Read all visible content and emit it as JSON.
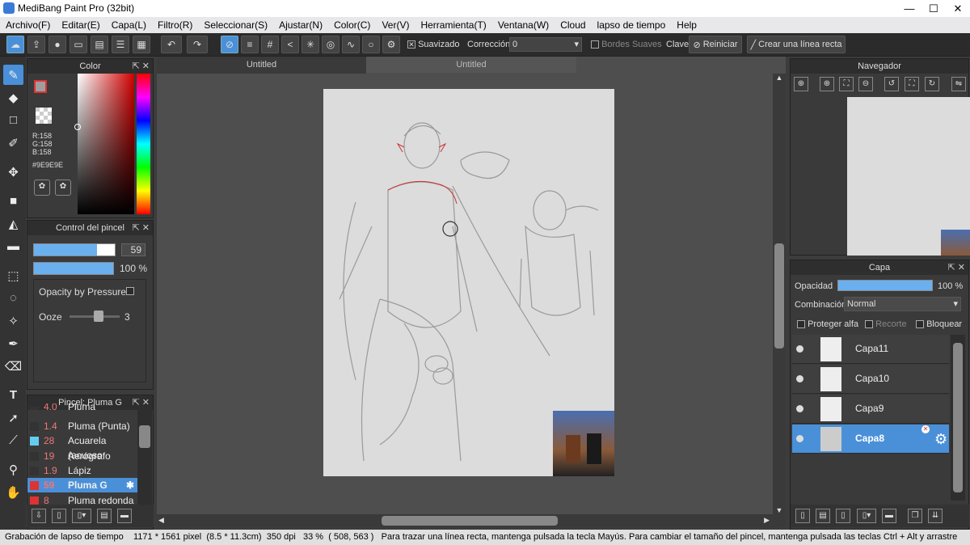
{
  "window": {
    "title": "MediBang Paint Pro (32bit)",
    "minimize": "—",
    "maximize": "☐",
    "close": "✕"
  },
  "menu": [
    "Archivo(F)",
    "Editar(E)",
    "Capa(L)",
    "Filtro(R)",
    "Seleccionar(S)",
    "Ajustar(N)",
    "Color(C)",
    "Ver(V)",
    "Herramienta(T)",
    "Ventana(W)",
    "Cloud",
    "lapso de tiempo",
    "Help"
  ],
  "toolbar": {
    "smoothing_label": "Suavizado",
    "correction_label": "Corrección",
    "correction_value": "0",
    "soft_edges_label": "Bordes Suaves",
    "clave_label": "Clave",
    "reset_label": "Reiniciar",
    "straight_line_label": "Crear una línea recta"
  },
  "tabs": [
    "Untitled",
    "Untitled"
  ],
  "color_panel": {
    "title": "Color",
    "r": "R:158",
    "g": "G:158",
    "b": "B:158",
    "hex": "#9E9E9E",
    "current_color": "#9e9e9e"
  },
  "brush_control": {
    "title": "Control del pincel",
    "size": "59",
    "opacity": "100 %",
    "opacity_pressure_label": "Opacity by Pressure",
    "ooze_label": "Ooze",
    "ooze_value": "3"
  },
  "brush_list": {
    "title": "Pincel: Pluma G",
    "items": [
      {
        "size": "4.0",
        "name": "Pluma",
        "color": "#333333"
      },
      {
        "size": "1.4",
        "name": "Pluma (Punta)",
        "color": "#333333"
      },
      {
        "size": "28",
        "name": "Acuarela (acuoso",
        "color": "#66ccee"
      },
      {
        "size": "19",
        "name": "Aerógrafo",
        "color": "#333333"
      },
      {
        "size": "1.9",
        "name": "Lápiz",
        "color": "#333333"
      },
      {
        "size": "59",
        "name": "Pluma G",
        "color": "#dd3333"
      },
      {
        "size": "8",
        "name": "Pluma redonda",
        "color": "#dd3333"
      }
    ]
  },
  "navigator": {
    "title": "Navegador"
  },
  "layers_panel": {
    "title": "Capa",
    "opacity_label": "Opacidad",
    "opacity_value": "100 %",
    "blend_label": "Combinación",
    "blend_value": "Normal",
    "protect_alpha": "Proteger alfa",
    "clip": "Recorte",
    "lock": "Bloquear",
    "layers": [
      "Capa11",
      "Capa10",
      "Capa9",
      "Capa8"
    ]
  },
  "status": {
    "timelapse": "Grabación de lapso de tiempo",
    "pixels": "1171 * 1561 pixel",
    "size_cm": "(8.5 * 11.3cm)",
    "dpi": "350 dpi",
    "zoom": "33 %",
    "coords": "( 508, 563 )",
    "hint": "Para trazar una línea recta, mantenga pulsada la tecla Mayús. Para cambiar el tamaño del pincel, mantenga pulsada las teclas Ctrl + Alt y arrastre"
  }
}
